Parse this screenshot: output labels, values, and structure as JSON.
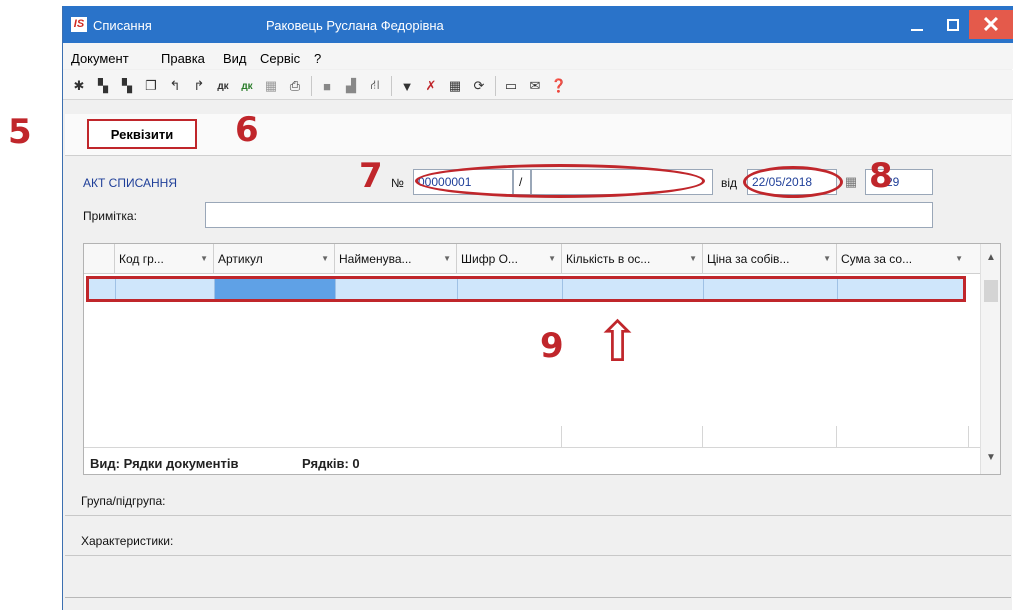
{
  "window": {
    "title": "Списання",
    "user": "Раковець Руслана Федорівна",
    "app_icon": "IS"
  },
  "menu": [
    "Документ",
    "Правка",
    "Вид",
    "Сервіс",
    "?"
  ],
  "toolbar": {
    "icons": [
      "new-icon",
      "copy-doc-icon",
      "move-doc-icon",
      "duplicate-icon",
      "undo-icon",
      "redo-icon",
      "dk-icon",
      "dk-green-icon",
      "calc-icon",
      "print-icon",
      "square-icon",
      "square2-icon",
      "tree-icon",
      "filter-icon",
      "clear-filter-icon",
      "table-icon",
      "refresh-icon",
      "form-icon",
      "mail-icon",
      "help-icon"
    ]
  },
  "tab": {
    "label": "Реквізити"
  },
  "form": {
    "act_label": "АКТ СПИСАННЯ",
    "number_label": "№",
    "number_value": "00000001",
    "number_sep": "/",
    "number_suffix": "",
    "date_label": "від",
    "date_value": "22/05/2018",
    "time_value": "29",
    "note_label": "Примітка:",
    "note_value": ""
  },
  "grid": {
    "columns": [
      "Код гр...",
      "Артикул",
      "Найменува...",
      "Шифр О...",
      "Кількість в ос...",
      "Ціна за собів...",
      "Сума за со..."
    ],
    "footer_view": "Вид: Рядки документів",
    "footer_rows": "Рядків: 0"
  },
  "sections": {
    "group": "Група/підгрупа:",
    "chars": "Характеристики:"
  },
  "callouts": {
    "c5": "5",
    "c6": "6",
    "c7": "7",
    "c8": "8",
    "c9": "9",
    "arrow": "⇧"
  },
  "colors": {
    "titlebar": "#2a73c9",
    "highlight": "#c0262b",
    "selection": "#cfe6fb"
  }
}
